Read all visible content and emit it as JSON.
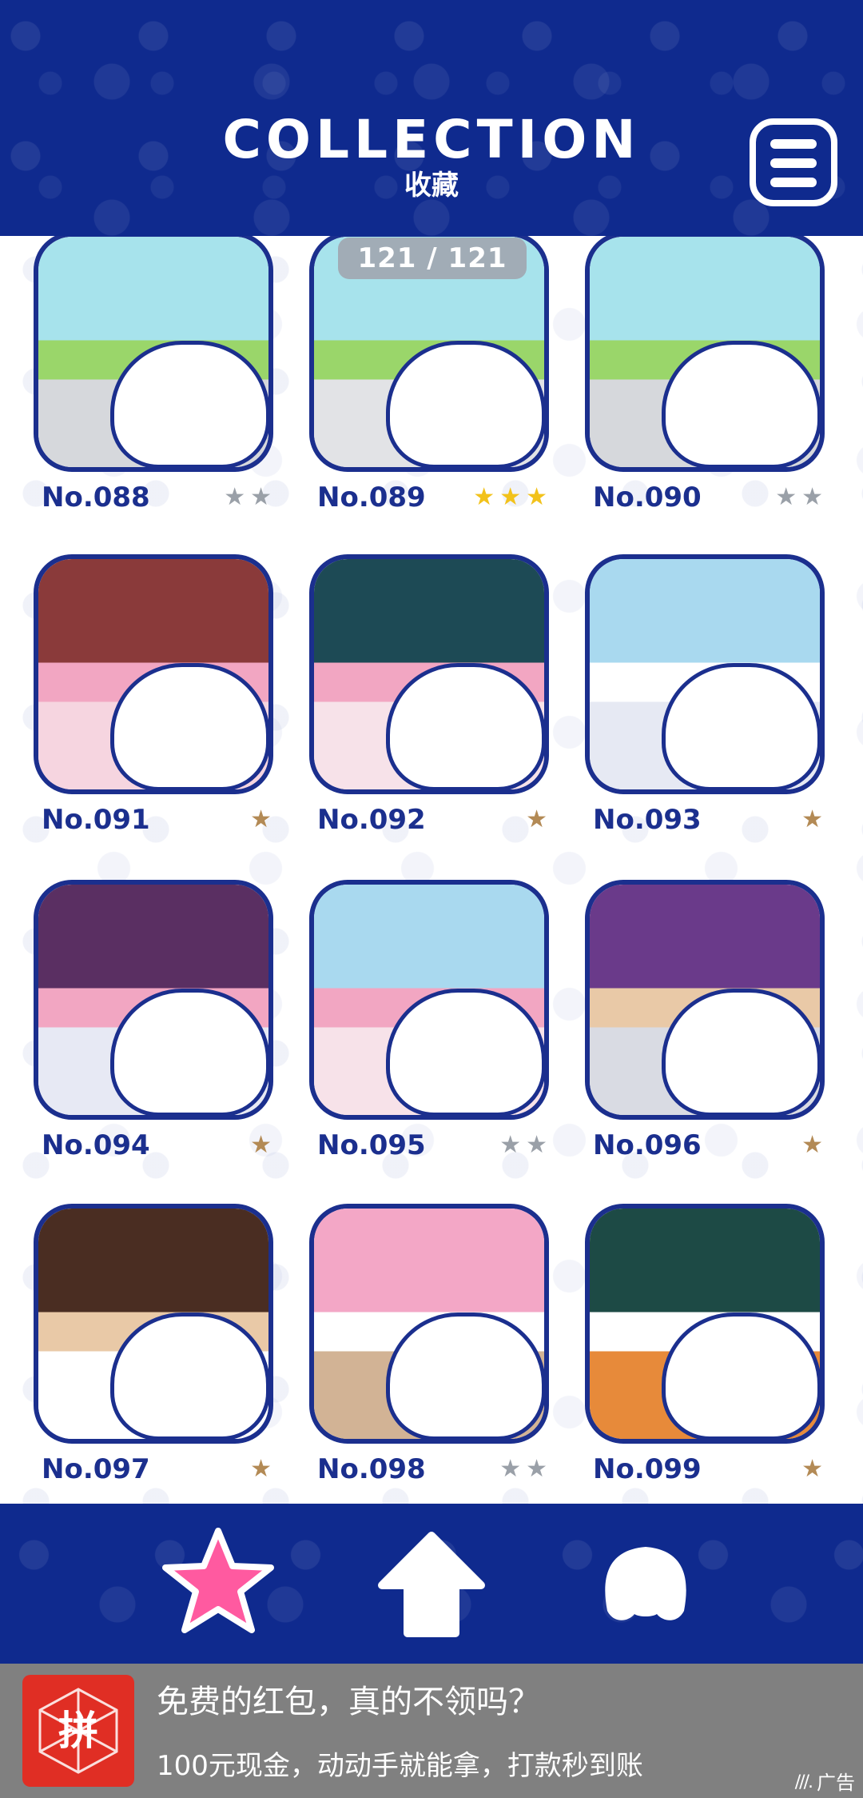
{
  "header": {
    "title": "COLLECTION",
    "subtitle": "收藏",
    "menu_icon": "hamburger-menu-icon"
  },
  "collection": {
    "progress": "121 / 121",
    "items": [
      {
        "number": "No.088",
        "stars": 2,
        "star_color": "#9aa0a8",
        "palette": [
          "#a7e3ec",
          "#9ad66a",
          "#d6d8dc"
        ]
      },
      {
        "number": "No.089",
        "stars": 3,
        "star_color": "#f2c21b",
        "palette": [
          "#a7e3ec",
          "#9ad66a",
          "#e2e3e6"
        ]
      },
      {
        "number": "No.090",
        "stars": 2,
        "star_color": "#9aa0a8",
        "palette": [
          "#a7e3ec",
          "#9ad66a",
          "#d6d8dc"
        ]
      },
      {
        "number": "No.091",
        "stars": 1,
        "star_color": "#b38a55",
        "palette": [
          "#8a3a3a",
          "#f2a6c2",
          "#f6d5e0"
        ]
      },
      {
        "number": "No.092",
        "stars": 1,
        "star_color": "#b38a55",
        "palette": [
          "#1d4a55",
          "#f2a6c2",
          "#f7e2e9"
        ]
      },
      {
        "number": "No.093",
        "stars": 1,
        "star_color": "#b38a55",
        "palette": [
          "#a9d9ef",
          "#ffffff",
          "#e6e9f3"
        ]
      },
      {
        "number": "No.094",
        "stars": 1,
        "star_color": "#b38a55",
        "palette": [
          "#5a2f62",
          "#f2a6c2",
          "#e7e9f4"
        ]
      },
      {
        "number": "No.095",
        "stars": 2,
        "star_color": "#9aa0a8",
        "palette": [
          "#a9d9ef",
          "#f2a6c2",
          "#f7e2e9"
        ]
      },
      {
        "number": "No.096",
        "stars": 1,
        "star_color": "#b38a55",
        "palette": [
          "#6a3a8a",
          "#e9c9a7",
          "#d9dbe3"
        ]
      },
      {
        "number": "No.097",
        "stars": 1,
        "star_color": "#b38a55",
        "palette": [
          "#4a2d22",
          "#e9c9a7",
          "#ffffff"
        ]
      },
      {
        "number": "No.098",
        "stars": 2,
        "star_color": "#9aa0a8",
        "palette": [
          "#f3a7c6",
          "#ffffff",
          "#d2b395"
        ]
      },
      {
        "number": "No.099",
        "stars": 1,
        "star_color": "#b38a55",
        "palette": [
          "#1d4a45",
          "#ffffff",
          "#e78a3a"
        ]
      }
    ]
  },
  "bottom_nav": {
    "items": [
      {
        "name": "collection",
        "icon": "star-icon",
        "color": "#ff5aa0"
      },
      {
        "name": "home",
        "icon": "home-icon",
        "color": "#ffffff"
      },
      {
        "name": "profile",
        "icon": "dog-head-icon",
        "color": "#ffffff"
      }
    ]
  },
  "ad": {
    "icon_text": "拼",
    "title": "免费的红包，真的不领吗？",
    "description": "100元现金，动动手就能拿，打款秒到账",
    "label": "广告"
  },
  "colors": {
    "brand_blue": "#0f2a8e",
    "card_border": "#1b2f8e",
    "active_nav": "#ff5aa0"
  }
}
